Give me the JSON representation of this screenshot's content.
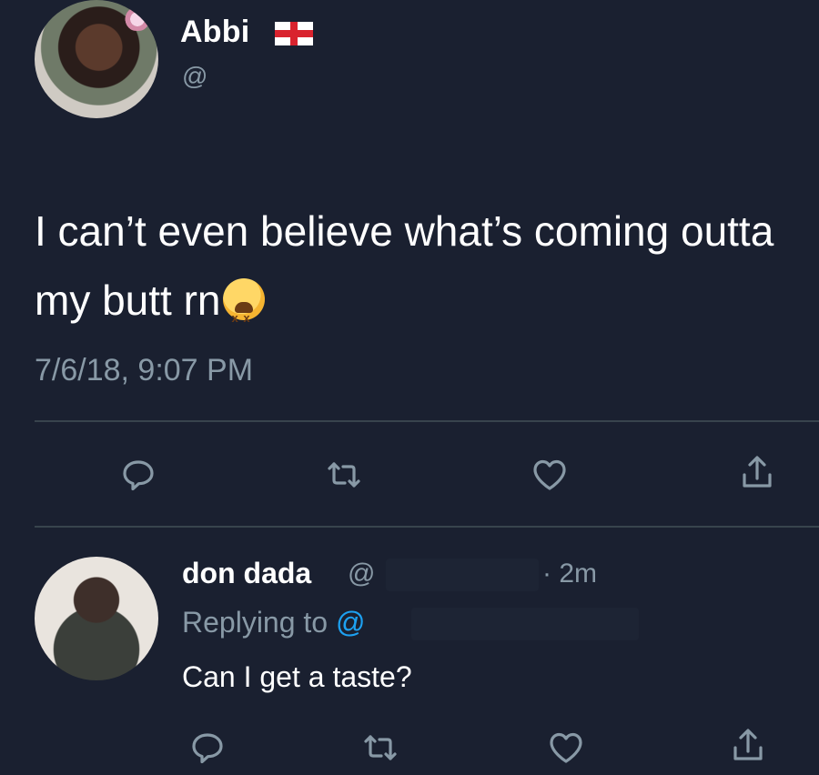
{
  "main_tweet": {
    "display_name": "Abbi",
    "handle": "@",
    "text": "I can’t even believe what’s coming outta my butt rn",
    "timestamp": "7/6/18, 9:07 PM",
    "flag_icon": "england-flag-icon",
    "emoji_icon": "tired-face-emoji"
  },
  "reply_tweet": {
    "display_name": "don dada",
    "handle": "@",
    "time_sep": "· 2m",
    "replying_label": "Replying to ",
    "replying_handle": "@",
    "text": "Can I get a taste?"
  },
  "actions": [
    "reply-icon",
    "retweet-icon",
    "like-icon",
    "share-icon"
  ],
  "colors": {
    "background": "#1a2030",
    "secondary_text": "#8899a6",
    "link": "#1da1f2",
    "divider": "#38444d"
  }
}
